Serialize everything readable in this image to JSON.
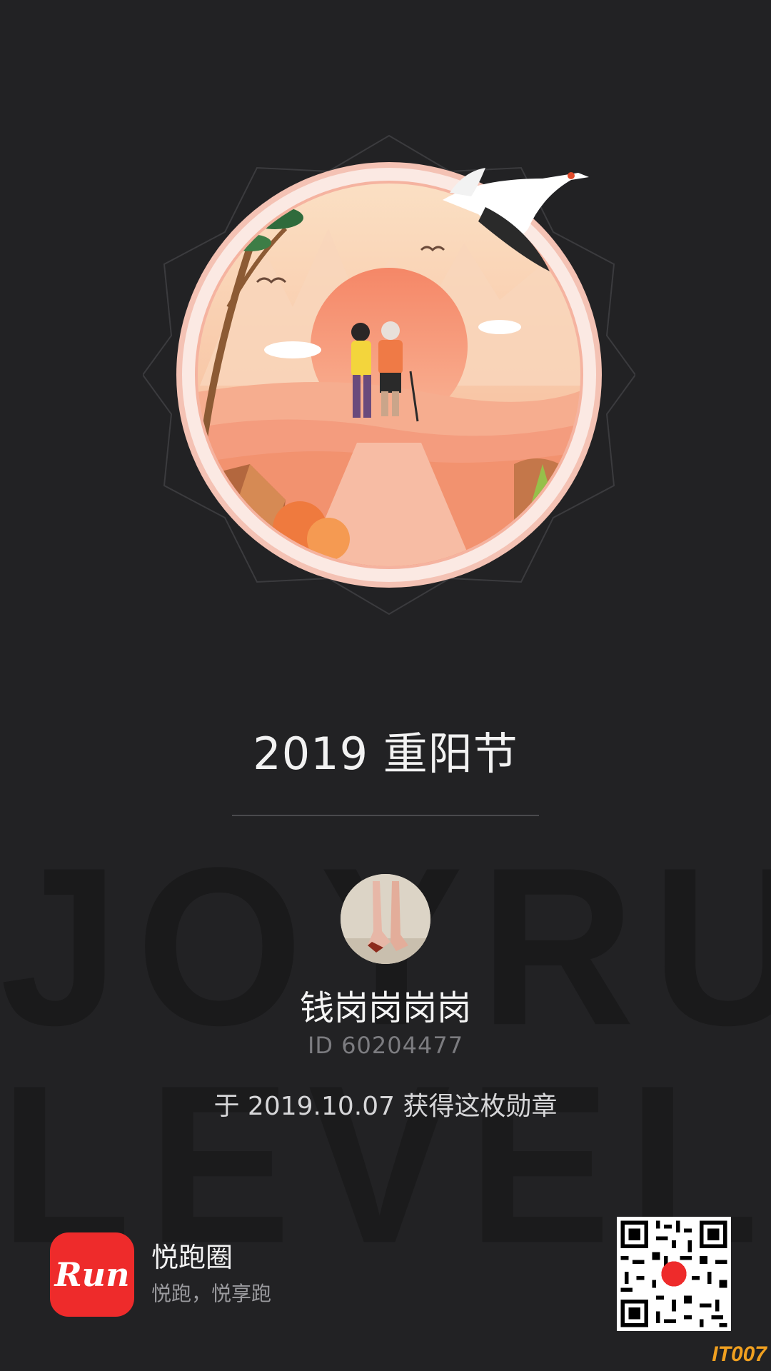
{
  "badge": {
    "title": "2019 重阳节"
  },
  "watermark": {
    "line1": "JOYRUN",
    "line2": "LEVEL"
  },
  "user": {
    "name": "钱岗岗岗岗",
    "id_text": "ID 60204477",
    "earned_text": "于 2019.10.07 获得这枚勋章"
  },
  "footer": {
    "app_icon_text": "Run",
    "app_name": "悦跑圈",
    "slogan": "悦跑，悦享跑"
  },
  "corner_logo": "IT007",
  "colors": {
    "background": "#222224",
    "brand_red": "#ee2b2b",
    "badge_ring": "#f6cfc4",
    "sun": "#f27b5c"
  }
}
